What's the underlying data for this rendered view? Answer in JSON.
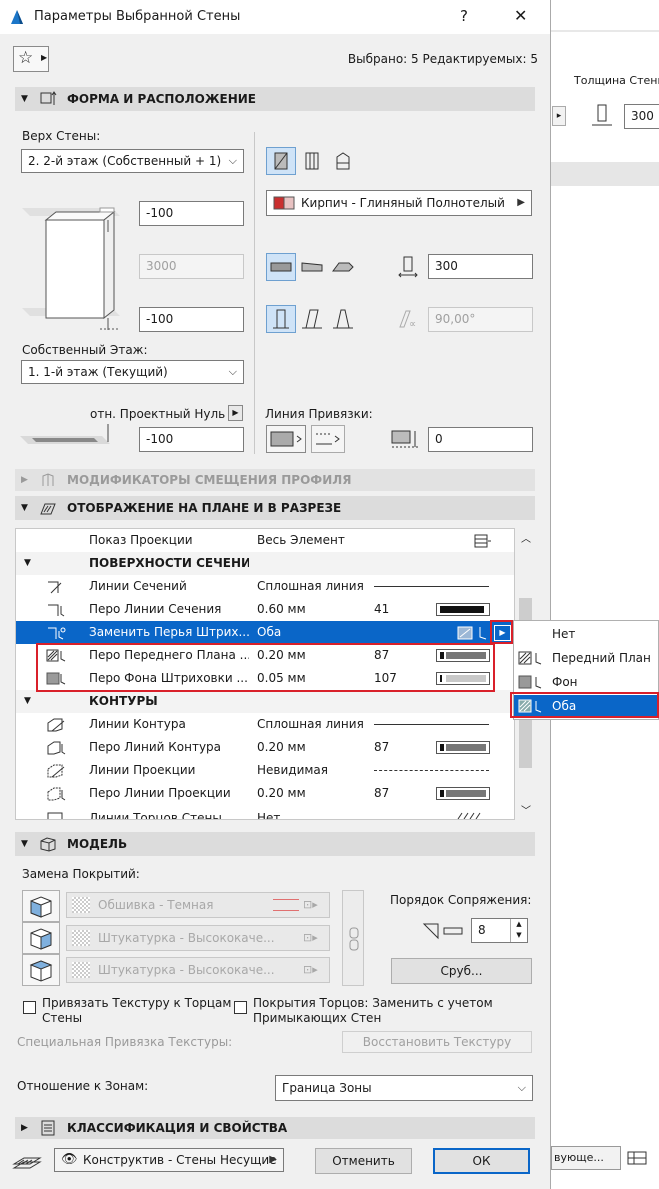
{
  "window": {
    "title": "Параметры Выбранной Стены",
    "help": "?",
    "close": "✕"
  },
  "header": {
    "selection_info": "Выбрано: 5 Редактируемых: 5"
  },
  "sections": {
    "shape": "ФОРМА И РАСПОЛОЖЕНИЕ",
    "modifiers": "МОДИФИКАТОРЫ СМЕЩЕНИЯ ПРОФИЛЯ",
    "display": "ОТОБРАЖЕНИЕ НА ПЛАНЕ И В РАЗРЕЗЕ",
    "model": "МОДЕЛЬ",
    "classification": "КЛАССИФИКАЦИЯ И СВОЙСТВА"
  },
  "shape": {
    "top_label": "Верх Стены:",
    "top_value": "2. 2-й этаж (Собственный + 1)",
    "top_offset": "-100",
    "height": "3000",
    "bottom_offset": "-100",
    "home_story_label": "Собственный Этаж:",
    "home_story_value": "1. 1-й этаж (Текущий)",
    "ref_level_label": "отн. Проектный Нуль",
    "ref_level_value": "-100",
    "material": "Кирпич - Глиняный Полнотелый",
    "thickness": "300",
    "angle": "90,00°",
    "ref_line_label": "Линия Привязки:",
    "ref_line_offset": "0"
  },
  "display": {
    "projection_row": {
      "name": "Показ Проекции",
      "value": "Весь Элемент"
    },
    "group_cut": "ПОВЕРХНОСТИ СЕЧЕНИЯ",
    "group_outlines": "КОНТУРЫ",
    "rows": [
      {
        "name": "Линии Сечений",
        "value": "Сплошная линия",
        "num": ""
      },
      {
        "name": "Перо Линии Сечения",
        "value": "0.60 мм",
        "num": "41"
      },
      {
        "name": "Заменить Перья Штрих...",
        "value": "Оба",
        "num": ""
      },
      {
        "name": "Перо Переднего Плана ...",
        "value": "0.20 мм",
        "num": "87"
      },
      {
        "name": "Перо Фона Штриховки ...",
        "value": "0.05 мм",
        "num": "107"
      },
      {
        "name": "Линии Контура",
        "value": "Сплошная линия",
        "num": ""
      },
      {
        "name": "Перо Линий Контура",
        "value": "0.20 мм",
        "num": "87"
      },
      {
        "name": "Линии Проекции",
        "value": "Невидимая",
        "num": ""
      },
      {
        "name": "Перо Линии Проекции",
        "value": "0.20 мм",
        "num": "87"
      },
      {
        "name": "Линии Торцов Стены",
        "value": "Нет",
        "num": ""
      }
    ]
  },
  "popup": {
    "items": [
      "Нет",
      "Передний План",
      "Фон",
      "Оба"
    ]
  },
  "model": {
    "surface_label": "Замена Покрытий:",
    "surfaces": [
      "Обшивка - Темная",
      "Штукатурка - Высококаче...",
      "Штукатурка - Высококаче..."
    ],
    "priority_label": "Порядок Сопряжения:",
    "priority_value": "8",
    "log_button": "Сруб...",
    "chk_texture_a": "Привязать Текстуру к Торцам",
    "chk_texture_b": "Стены",
    "chk_surfaces_a": "Покрытия Торцов: Заменить с учетом",
    "chk_surfaces_b": "Примыкающих Стен",
    "custom_texture_label": "Специальная Привязка Текстуры:",
    "reset_texture": "Восстановить Текстуру",
    "zone_label": "Отношение к Зонам:",
    "zone_value": "Граница Зоны"
  },
  "footer": {
    "layer": "Конструктив - Стены Несущие",
    "cancel": "Отменить",
    "ok": "ОК"
  },
  "background": {
    "thickness_label": "Толщина Стены:",
    "thickness_value": "300",
    "bottom_combo": "вующе..."
  }
}
